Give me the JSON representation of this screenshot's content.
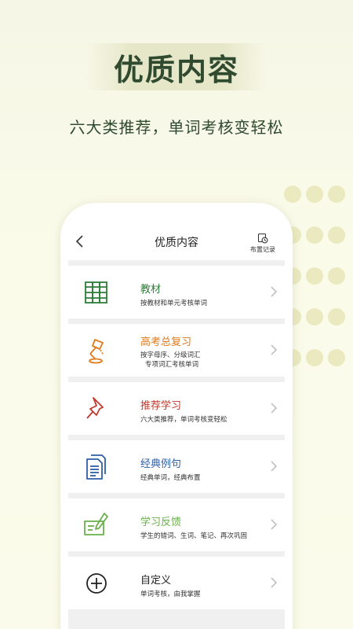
{
  "hero": {
    "title": "优质内容",
    "subtitle": "六大类推荐，单词考核变轻松"
  },
  "nav": {
    "title": "优质内容",
    "record_label": "布置记录"
  },
  "items": [
    {
      "title": "教材",
      "desc": "按教材和单元考核单词",
      "color": "#2e7d3a",
      "icon": "book-shelf-icon"
    },
    {
      "title": "高考总复习",
      "desc": "按字母序、分级词汇",
      "desc2": "专项词汇考核单词",
      "color": "#e07a1a",
      "icon": "desk-lamp-icon"
    },
    {
      "title": "推荐学习",
      "desc": "六大类推荐，单词考核变轻松",
      "color": "#c0392b",
      "icon": "pushpin-icon"
    },
    {
      "title": "经典例句",
      "desc": "经典单词，经典布置",
      "color": "#2d5fa8",
      "icon": "documents-icon"
    },
    {
      "title": "学习反馈",
      "desc": "学生的错词、生词、笔记、再次巩固",
      "color": "#6ab04c",
      "icon": "feedback-pencil-icon"
    },
    {
      "title": "自定义",
      "desc": "单词考核，由我掌握",
      "color": "#222222",
      "icon": "plus-circle-icon"
    }
  ]
}
